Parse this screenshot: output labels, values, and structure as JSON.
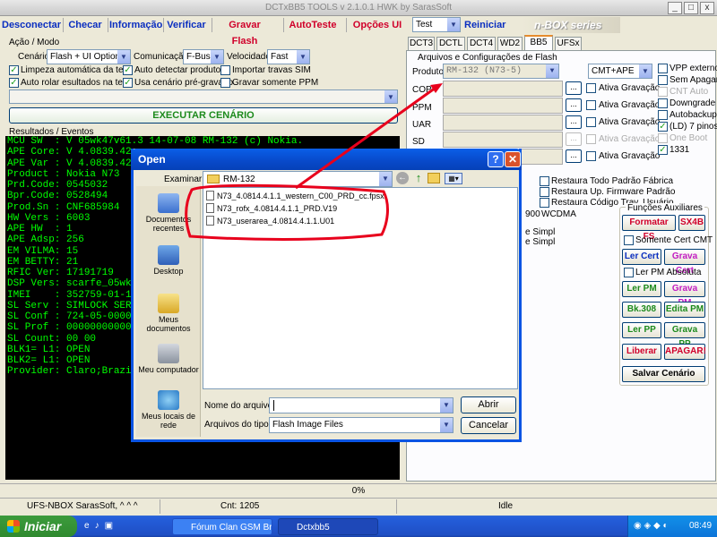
{
  "window": {
    "title": "DCTxBB5 TOOLS v 2.1.0.1 HWK by SarasSoft"
  },
  "toolbar": {
    "items": [
      "Desconectar",
      "Checar",
      "Informação",
      "Verificar",
      "Gravar Flash",
      "AutoTeste",
      "Opções UI"
    ],
    "test_select": "Test",
    "restart": "Reiniciar",
    "series_logo": "n-BOX series"
  },
  "modo": {
    "group_title": "Ação / Modo",
    "cenario_label": "Cenário",
    "cenario_value": "Flash + UI Options",
    "comunicacao_label": "Comunicação",
    "comunicacao_value": "F-Bus",
    "velocidade_label": "Velocidade",
    "velocidade_value": "Fast",
    "checks": [
      {
        "label": "Limpeza automática da tela",
        "checked": true
      },
      {
        "label": "Auto detectar produto",
        "checked": true
      },
      {
        "label": "Importar travas SIM",
        "checked": false
      },
      {
        "label": "Auto rolar esultados na tela",
        "checked": true
      },
      {
        "label": "Usa cenário pré-gravado",
        "checked": true
      },
      {
        "label": "Gravar somente PPM",
        "checked": false
      }
    ],
    "execute": "EXECUTAR CENÁRIO"
  },
  "results": {
    "title": "Resultados / Eventos",
    "lines": [
      "MCU SW  : V 05wk47v61.3 14-07-08 RM-132 (c) Nokia.",
      "APE Core: V 4.0839.42.",
      "APE Var : V 4.0839.42.",
      "Product : Nokia N73",
      "Prd.Code: 0545032",
      "Bpr.Code: 0528494",
      "Prod.Sn : CNF685984",
      "HW Vers : 6003",
      "APE HW  : 1",
      "APE Adsp: 256",
      "EM VILMA: 15",
      "EM BETTY: 21",
      "RFIC Ver: 17191719",
      "DSP Vers: scarfe_05wk4",
      "IMEI    : 352759-01-14",
      "SL Serv : SIMLOCK SERV",
      "SL Conf : 724-05-00000",
      "SL Prof : 000000000000",
      "SL Count: 00 00",
      "BLK1= L1: OPEN",
      "BLK2= L1: OPEN",
      "Provider: Claro;Brazil"
    ]
  },
  "tabs": [
    "DCT3",
    "DCTL",
    "DCT4",
    "WD2",
    "BB5",
    "UFSx"
  ],
  "flash": {
    "group_title": "Arquivos e Configurações de Flash",
    "produto_label": "Produto",
    "produto_value": "RM-132  (N73-5)",
    "mode_select": "CMT+APE",
    "rows": [
      "COP",
      "PPM",
      "UAR",
      "SD"
    ],
    "ativa": "Ativa Gravação",
    "right_checks": [
      {
        "label": "VPP externo",
        "checked": false
      },
      {
        "label": "Sem Apagar",
        "checked": false
      },
      {
        "label": "CNT Auto",
        "checked": false
      },
      {
        "label": "Downgrade",
        "checked": false
      },
      {
        "label": "Autobackup",
        "checked": false
      },
      {
        "label": "(LD) 7 pinos",
        "checked": true
      },
      {
        "label": "One Boot",
        "checked": false
      },
      {
        "label": "1331",
        "checked": true
      }
    ],
    "restore": [
      "Restaura Todo Padrão Fábrica",
      "Restaura Up. Firmware Padrão",
      "Restaura Código Trav. Usuário"
    ],
    "wcdma_partial": "900",
    "wcdma": "WCDMA",
    "simpl1": "e Simpl",
    "simpl2": "e Simpl"
  },
  "aux": {
    "title": "Funções Auxiliares",
    "formatar": "Formatar FS",
    "s4b": "SX4B",
    "somente": "Somente Cert CMT",
    "ler_cert": "Ler Cert",
    "grava_cert": "Grava Cert",
    "ler_pm_abs": "Ler PM Absoluta",
    "ler_pm": "Ler PM",
    "grava_pm": "Grava PM",
    "bk308": "Bk.308",
    "edita_pm": "Edita PM",
    "ler_pp": "Ler PP",
    "grava_pp": "Grava PP",
    "liberar": "Liberar",
    "apagar": "APAGAR!",
    "salvar": "Salvar Cenário"
  },
  "dialog": {
    "title": "Open",
    "examinar_label": "Examinar:",
    "folder": "RM-132",
    "places": [
      "Documentos recentes",
      "Desktop",
      "Meus documentos",
      "Meu computador",
      "Meus locais de rede"
    ],
    "files": [
      "N73_4.0814.4.1.1_western_C00_PRD_cc.fpsx",
      "N73_rofx_4.0814.4.1.1_PRD.V19",
      "N73_userarea_4.0814.4.1.1.U01"
    ],
    "filename_label": "Nome do arquivo:",
    "filename_value": "",
    "filetype_label": "Arquivos do tipo:",
    "filetype_value": "Flash Image Files",
    "open_button": "Abrir",
    "cancel_button": "Cancelar"
  },
  "status": {
    "progress": "0%",
    "ufs": "UFS-NBOX  SarasSoft, ^ ^ ^",
    "cnt": "Cnt: 1205",
    "idle": "Idle"
  },
  "taskbar": {
    "start": "Iniciar",
    "tasks": [
      "Fórum Clan GSM Brasi...",
      "Dctxbb5"
    ],
    "clock": "08:49"
  },
  "colors": {
    "accent_red": "#e8001c",
    "terminal_green": "#00ff00",
    "xp_blue": "#0a54e3"
  }
}
